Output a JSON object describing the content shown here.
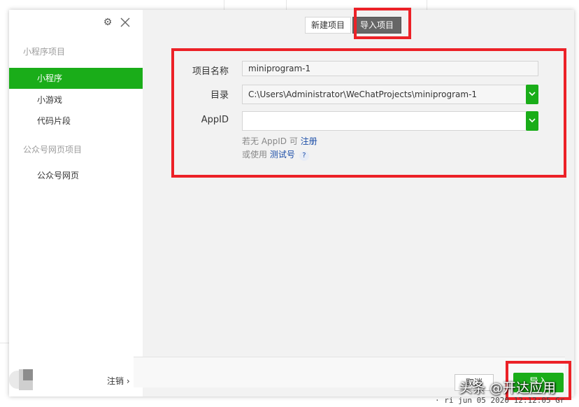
{
  "sidebar": {
    "sections": [
      {
        "title": "小程序项目",
        "items": [
          {
            "label": "小程序",
            "active": true
          },
          {
            "label": "小游戏",
            "active": false
          },
          {
            "label": "代码片段",
            "active": false
          }
        ]
      },
      {
        "title": "公众号网页项目",
        "items": [
          {
            "label": "公众号网页",
            "active": false
          }
        ]
      }
    ],
    "logout_label": "注销 ›",
    "icons": {
      "settings": "gear-icon",
      "close": "close-icon"
    }
  },
  "tabs": {
    "new_label": "新建项目",
    "import_label": "导入项目",
    "active": "import"
  },
  "form": {
    "name_label": "项目名称",
    "name_value": "miniprogram-1",
    "dir_label": "目录",
    "dir_value": "C:\\Users\\Administrator\\WeChatProjects\\miniprogram-1",
    "appid_label": "AppID",
    "appid_value": "",
    "hint1_prefix": "若无 AppID 可",
    "hint1_link": "注册",
    "hint2_prefix": "或使用",
    "hint2_link": "测试号",
    "help_glyph": "?"
  },
  "footer": {
    "cancel_label": "取消",
    "import_label": "导入"
  },
  "overlay": {
    "watermark": "头条 @开达应用",
    "code_fragment": "· ri jun 05 2020 12:12:05 Gr"
  },
  "colors": {
    "accent_green": "#1aad19",
    "annotation_red": "#ec2127",
    "link_blue": "#1c4ea8"
  }
}
